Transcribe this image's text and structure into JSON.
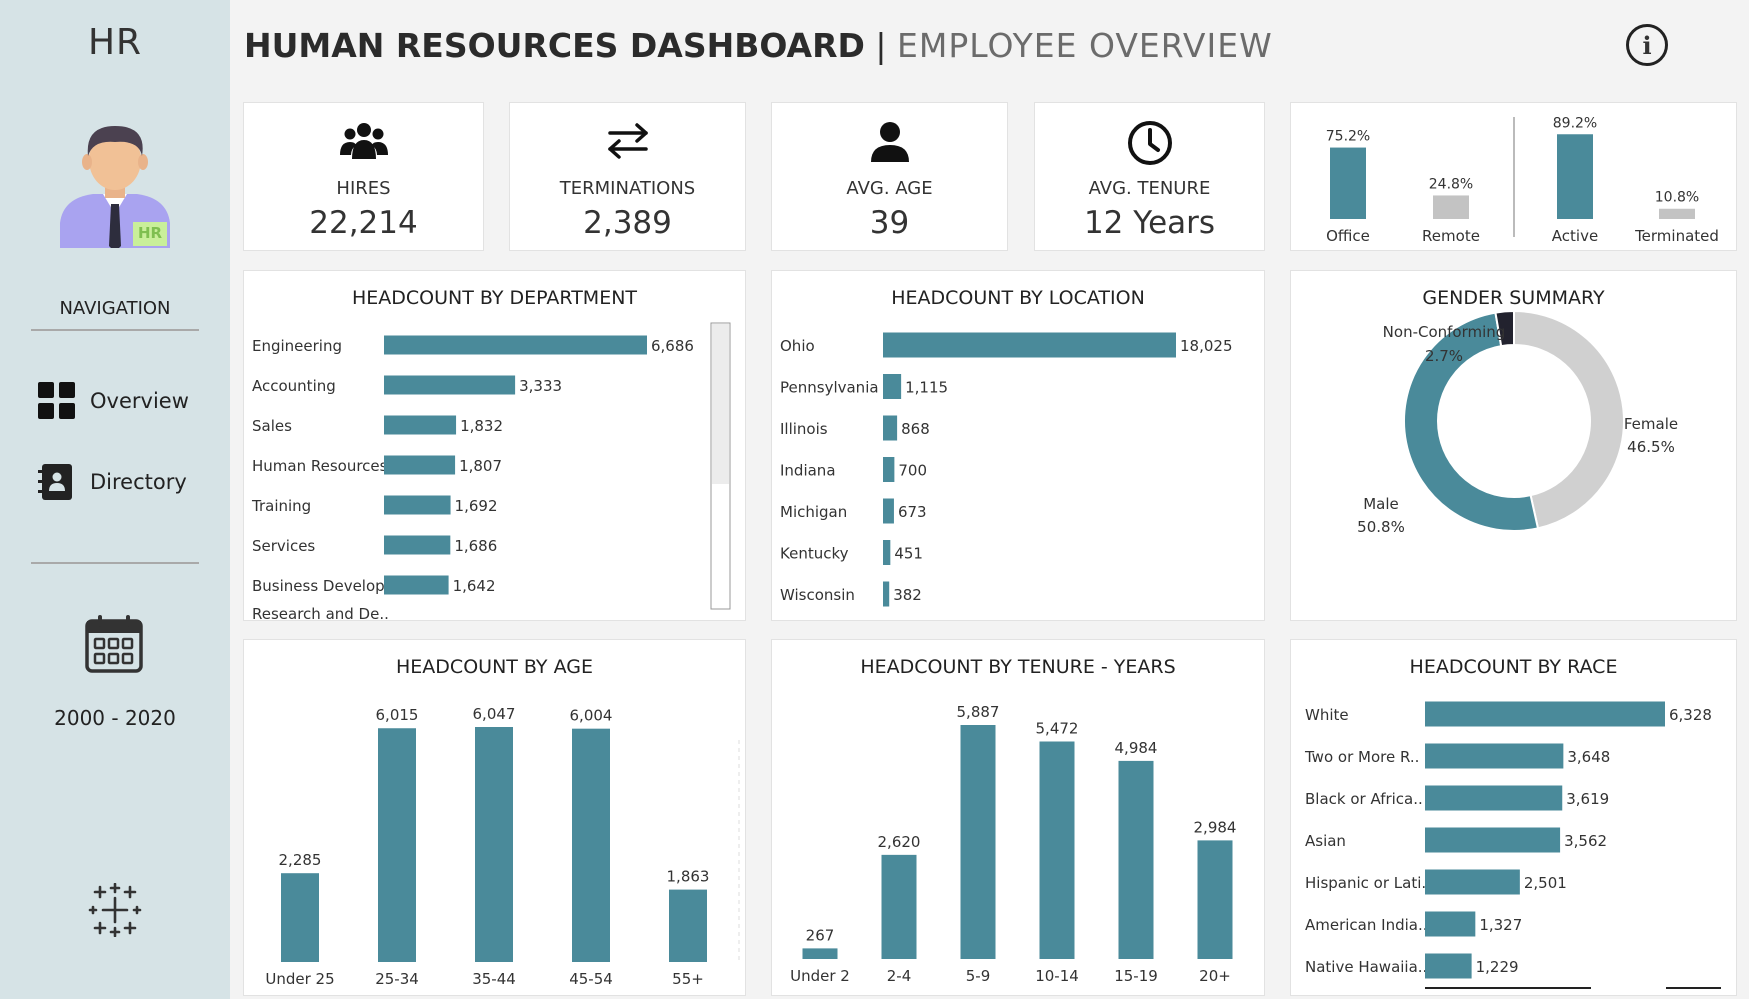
{
  "sidebar": {
    "title": "HR",
    "avatar_badge": "HR",
    "navigation_label": "NAVIGATION",
    "nav_items": [
      {
        "label": "Overview",
        "icon": "grid-icon"
      },
      {
        "label": "Directory",
        "icon": "address-book-icon"
      }
    ],
    "date_range": "2000 - 2020"
  },
  "header": {
    "title_main": "HUMAN RESOURCES DASHBOARD",
    "separator": "|",
    "title_sub": "EMPLOYEE OVERVIEW"
  },
  "kpis": [
    {
      "label": "HIRES",
      "value": "22,214",
      "icon": "people-group-icon"
    },
    {
      "label": "TERMINATIONS",
      "value": "2,389",
      "icon": "swap-arrows-icon"
    },
    {
      "label": "AVG. AGE",
      "value": "39",
      "icon": "person-icon"
    },
    {
      "label": "AVG. TENURE",
      "value": "12 Years",
      "icon": "clock-icon"
    }
  ],
  "colors": {
    "bar": "#4a8a9a",
    "grey": "#c3c3c3",
    "dark": "#22222e",
    "sidebar": "#d6e3e6"
  },
  "chart_data": [
    {
      "type": "bar",
      "title": "",
      "categories": [
        "Office",
        "Remote"
      ],
      "values": [
        75.2,
        24.8
      ],
      "labels": [
        "75.2%",
        "24.8%"
      ]
    },
    {
      "type": "bar",
      "title": "",
      "categories": [
        "Active",
        "Terminated"
      ],
      "values": [
        89.2,
        10.8
      ],
      "labels": [
        "89.2%",
        "10.8%"
      ]
    },
    {
      "type": "bar",
      "title": "HEADCOUNT BY DEPARTMENT",
      "orientation": "horizontal",
      "categories": [
        "Engineering",
        "Accounting",
        "Sales",
        "Human Resources",
        "Training",
        "Services",
        "Business Develop.."
      ],
      "values": [
        6686,
        3333,
        1832,
        1807,
        1692,
        1686,
        1642
      ],
      "labels": [
        "6,686",
        "3,333",
        "1,832",
        "1,807",
        "1,692",
        "1,686",
        "1,642"
      ],
      "partial_label": "Research and De..",
      "scrollbar": true
    },
    {
      "type": "bar",
      "title": "HEADCOUNT BY LOCATION",
      "orientation": "horizontal",
      "categories": [
        "Ohio",
        "Pennsylvania",
        "Illinois",
        "Indiana",
        "Michigan",
        "Kentucky",
        "Wisconsin"
      ],
      "values": [
        18025,
        1115,
        868,
        700,
        673,
        451,
        382
      ],
      "labels": [
        "18,025",
        "1,115",
        "868",
        "700",
        "673",
        "451",
        "382"
      ]
    },
    {
      "type": "pie",
      "title": "GENDER SUMMARY",
      "donut": true,
      "categories": [
        "Male",
        "Female",
        "Non-Conforming"
      ],
      "values": [
        50.8,
        46.5,
        2.7
      ],
      "labels": [
        "50.8%",
        "46.5%",
        "2.7%"
      ]
    },
    {
      "type": "bar",
      "title": "HEADCOUNT BY AGE",
      "categories": [
        "Under 25",
        "25-34",
        "35-44",
        "45-54",
        "55+"
      ],
      "values": [
        2285,
        6015,
        6047,
        6004,
        1863
      ],
      "labels": [
        "2,285",
        "6,015",
        "6,047",
        "6,004",
        "1,863"
      ]
    },
    {
      "type": "bar",
      "title": "HEADCOUNT BY TENURE - YEARS",
      "categories": [
        "Under 2",
        "2-4",
        "5-9",
        "10-14",
        "15-19",
        "20+"
      ],
      "values": [
        267,
        2620,
        5887,
        5472,
        4984,
        2984
      ],
      "labels": [
        "267",
        "2,620",
        "5,887",
        "5,472",
        "4,984",
        "2,984"
      ]
    },
    {
      "type": "bar",
      "title": "HEADCOUNT BY RACE",
      "orientation": "horizontal",
      "categories": [
        "White",
        "Two or More R..",
        "Black or Africa..",
        "Asian",
        "Hispanic or Lati..",
        "American India..",
        "Native Hawaiia.."
      ],
      "values": [
        6328,
        3648,
        3619,
        3562,
        2501,
        1327,
        1229
      ],
      "labels": [
        "6,328",
        "3,648",
        "3,619",
        "3,562",
        "2,501",
        "1,327",
        "1,229"
      ]
    }
  ]
}
